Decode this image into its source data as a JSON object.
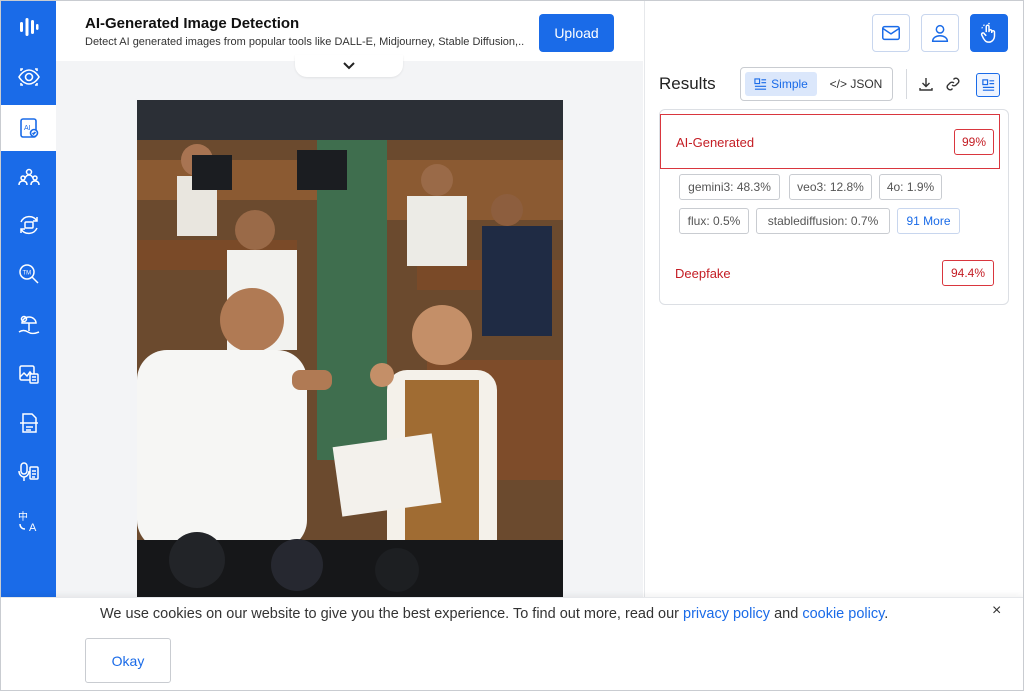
{
  "colors": {
    "brand": "#1a6be8",
    "danger": "#c41d24",
    "sidebar_bg": "#1a6be8"
  },
  "sidebar": {
    "items": [
      {
        "icon": "logo-bars-icon",
        "active": false
      },
      {
        "icon": "eye-scan-icon",
        "active": false
      },
      {
        "icon": "ai-detect-icon",
        "active": true
      },
      {
        "icon": "people-group-icon",
        "active": false
      },
      {
        "icon": "image-refresh-icon",
        "active": false
      },
      {
        "icon": "trademark-search-icon",
        "active": false
      },
      {
        "icon": "beach-scene-icon",
        "active": false
      },
      {
        "icon": "image-document-icon",
        "active": false
      },
      {
        "icon": "document-scan-icon",
        "active": false
      },
      {
        "icon": "voice-transcript-icon",
        "active": false
      },
      {
        "icon": "translate-icon",
        "active": false
      }
    ]
  },
  "header": {
    "title": "AI-Generated Image Detection",
    "subtitle": "Detect AI generated images from popular tools like DALL-E, Midjourney, Stable Diffusion,...",
    "upload_label": "Upload"
  },
  "topbar": {
    "icons": [
      "mail-icon",
      "user-icon",
      "touch-hand-icon"
    ]
  },
  "results": {
    "label": "Results",
    "view_simple": "Simple",
    "view_json": "</> JSON",
    "ai_generated": {
      "label": "AI-Generated",
      "value": "99%"
    },
    "chips": [
      {
        "text": "gemini3: 48.3%"
      },
      {
        "text": "veo3: 12.8%"
      },
      {
        "text": "4o: 1.9%"
      },
      {
        "text": "flux: 0.5%"
      },
      {
        "text": "stablediffusion: 0.7%"
      }
    ],
    "more_label": "91 More",
    "deepfake": {
      "label": "Deepfake",
      "value": "94.4%"
    }
  },
  "cookie": {
    "text_before": "We use cookies on our website to give you the best experience. To find out more, read our ",
    "privacy_link": "privacy policy",
    "text_and": " and ",
    "cookie_link": "cookie policy",
    "text_after": ".",
    "close_label": "×",
    "okay_label": "Okay"
  }
}
